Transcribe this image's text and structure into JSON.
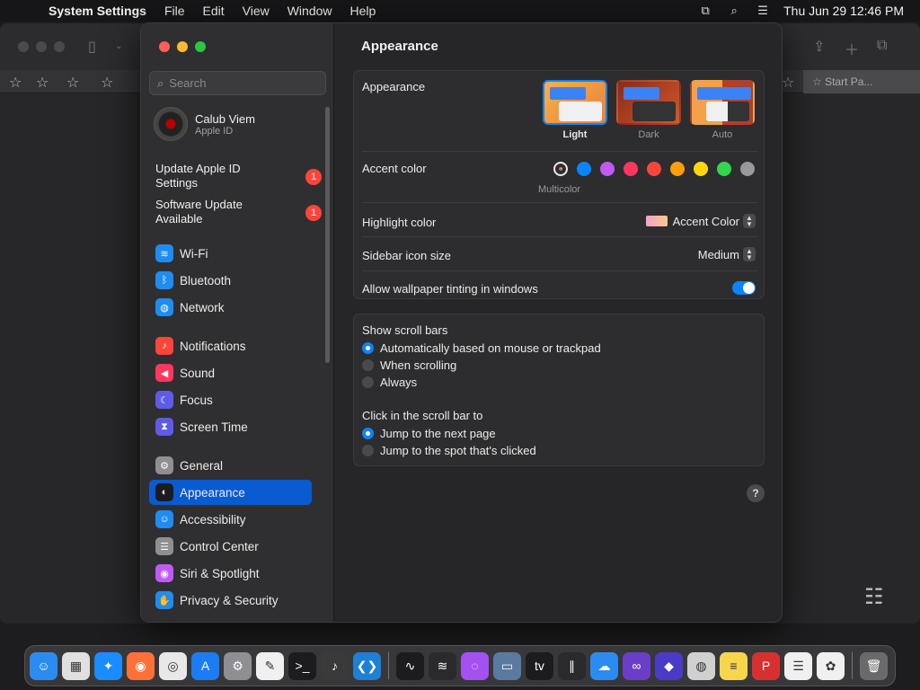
{
  "menubar": {
    "app_name": "System Settings",
    "menus": [
      "File",
      "Edit",
      "View",
      "Window",
      "Help"
    ],
    "datetime": "Thu Jun 29  12:46 PM"
  },
  "background_window": {
    "tab_label": "Start Pa..."
  },
  "sidebar": {
    "search_placeholder": "Search",
    "profile": {
      "name": "Calub Viem",
      "subtitle": "Apple ID"
    },
    "notices": [
      {
        "label": "Update Apple ID Settings",
        "badge": "1"
      },
      {
        "label": "Software Update Available",
        "badge": "1"
      }
    ],
    "items": [
      {
        "label": "Wi-Fi",
        "icon": "wifi-icon",
        "color": "#1e8cf0"
      },
      {
        "label": "Bluetooth",
        "icon": "bluetooth-icon",
        "color": "#1e8cf0"
      },
      {
        "label": "Network",
        "icon": "globe-icon",
        "color": "#1e8cf0"
      },
      {
        "label": "Notifications",
        "icon": "bell-icon",
        "color": "#ff453a"
      },
      {
        "label": "Sound",
        "icon": "speaker-icon",
        "color": "#ff375f"
      },
      {
        "label": "Focus",
        "icon": "moon-icon",
        "color": "#5e5ce6"
      },
      {
        "label": "Screen Time",
        "icon": "hourglass-icon",
        "color": "#5e5ce6"
      },
      {
        "label": "General",
        "icon": "gear-icon",
        "color": "#8e8e93"
      },
      {
        "label": "Appearance",
        "icon": "appearance-icon",
        "color": "#1c1c1e"
      },
      {
        "label": "Accessibility",
        "icon": "accessibility-icon",
        "color": "#1e8cf0"
      },
      {
        "label": "Control Center",
        "icon": "control-center-icon",
        "color": "#8e8e93"
      },
      {
        "label": "Siri & Spotlight",
        "icon": "siri-icon",
        "color": "#bf5af2"
      },
      {
        "label": "Privacy & Security",
        "icon": "hand-icon",
        "color": "#1e8cf0"
      }
    ],
    "active": "Appearance"
  },
  "main": {
    "title": "Appearance",
    "appearance": {
      "label": "Appearance",
      "options": [
        "Light",
        "Dark",
        "Auto"
      ],
      "selected": "Light"
    },
    "accent": {
      "label": "Accent color",
      "caption": "Multicolor",
      "colors": [
        "#ffffff",
        "#0a84ff",
        "#bf5af2",
        "#ff375f",
        "#ff453a",
        "#ff9f0a",
        "#ffd60a",
        "#32d74b",
        "#98989d"
      ]
    },
    "highlight": {
      "label": "Highlight color",
      "value": "Accent Color"
    },
    "sidebar_icon_size": {
      "label": "Sidebar icon size",
      "value": "Medium"
    },
    "wallpaper_tinting": {
      "label": "Allow wallpaper tinting in windows",
      "enabled": true
    },
    "scroll_bars": {
      "label": "Show scroll bars",
      "options": [
        "Automatically based on mouse or trackpad",
        "When scrolling",
        "Always"
      ],
      "selected": 0
    },
    "click_scroll": {
      "label": "Click in the scroll bar to",
      "options": [
        "Jump to the next page",
        "Jump to the spot that's clicked"
      ],
      "selected": 0
    },
    "help": "?"
  },
  "dock": {
    "apps": [
      {
        "name": "finder-icon",
        "color": "#2a8cf0",
        "glyph": "☺"
      },
      {
        "name": "launchpad-icon",
        "color": "#e0e0e0",
        "glyph": "▦"
      },
      {
        "name": "safari-icon",
        "color": "#1a8cff",
        "glyph": "✦"
      },
      {
        "name": "firefox-icon",
        "color": "#ff7139",
        "glyph": "◉"
      },
      {
        "name": "chrome-icon",
        "color": "#e8e8e8",
        "glyph": "◎"
      },
      {
        "name": "app-store-icon",
        "color": "#1b7cf5",
        "glyph": "A"
      },
      {
        "name": "system-settings-icon",
        "color": "#8e8e93",
        "glyph": "⚙"
      },
      {
        "name": "textedit-icon",
        "color": "#f0f0f0",
        "glyph": "✎"
      },
      {
        "name": "terminal-icon",
        "color": "#1c1c1e",
        "glyph": ">_"
      },
      {
        "name": "guitar-icon",
        "color": "#3a3a3a",
        "glyph": "♪"
      },
      {
        "name": "vscode-icon",
        "color": "#1e7fd6",
        "glyph": "❮❯"
      },
      {
        "name": "activity-monitor-icon",
        "color": "#1c1c1e",
        "glyph": "∿"
      },
      {
        "name": "audio-icon",
        "color": "#2a2a2c",
        "glyph": "≋"
      },
      {
        "name": "podcasts-icon",
        "color": "#a550f0",
        "glyph": "◌"
      },
      {
        "name": "preview-icon",
        "color": "#5a7aa0",
        "glyph": "▭"
      },
      {
        "name": "apple-tv-icon",
        "color": "#1c1c1e",
        "glyph": "tv"
      },
      {
        "name": "voice-memo-icon",
        "color": "#2a2a2c",
        "glyph": "∥"
      },
      {
        "name": "cloud-icon",
        "color": "#2a8cf0",
        "glyph": "☁"
      },
      {
        "name": "visual-studio-icon",
        "color": "#6a3ec8",
        "glyph": "∞"
      },
      {
        "name": "shortcuts-icon",
        "color": "#4a3ac8",
        "glyph": "◆"
      },
      {
        "name": "proxyman-icon",
        "color": "#d0d0d0",
        "glyph": "◍"
      },
      {
        "name": "notes-icon",
        "color": "#f7d64a",
        "glyph": "≡"
      },
      {
        "name": "pdf-icon",
        "color": "#d83030",
        "glyph": "P"
      },
      {
        "name": "reminders-icon",
        "color": "#f0f0f0",
        "glyph": "☰"
      },
      {
        "name": "photos-icon",
        "color": "#f0f0f0",
        "glyph": "✿"
      },
      {
        "name": "trash-icon",
        "color": "#6a6a6c",
        "glyph": "🗑"
      }
    ]
  }
}
